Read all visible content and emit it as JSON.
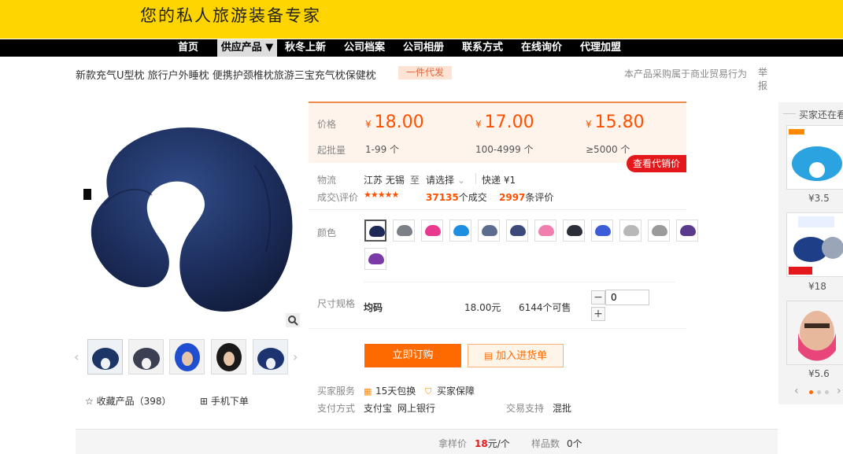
{
  "banner": {
    "slogan": "您的私人旅游装备专家"
  },
  "nav": {
    "items": [
      "首页",
      "供应产品 ▼",
      "秋冬上新",
      "公司档案",
      "公司相册",
      "联系方式",
      "在线询价",
      "代理加盟"
    ],
    "active_index": 1
  },
  "product": {
    "title": "新款充气U型枕 旅行户外睡枕 便携护颈椎枕旅游三宝充气枕保健枕",
    "tag": "一件代发",
    "trade_note": "本产品采购属于商业贸易行为",
    "report": "举报"
  },
  "gallery": {
    "favorite": "收藏产品（398）",
    "mobile_order": "手机下单",
    "thumb_colors": [
      "#1d3566",
      "#3a4052",
      "#1f4fd0",
      "#1a1a1a",
      "#1e3470"
    ]
  },
  "pricing": {
    "price_label": "价格",
    "moq_label": "起批量",
    "currency": "¥",
    "tiers": [
      {
        "price": "18.00",
        "range": "1-99 个"
      },
      {
        "price": "17.00",
        "range": "100-4999 个"
      },
      {
        "price": "15.80",
        "range": "≥5000 个"
      }
    ],
    "agent_price_button": "查看代销价"
  },
  "logistics": {
    "label": "物流",
    "origin": "江苏 无锡",
    "to": "至",
    "select": "请选择",
    "express": "快递 ¥1"
  },
  "deals": {
    "label": "成交\\评价",
    "stars": "★★★★★",
    "count": "37135",
    "count_suffix": "个成交",
    "reviews": "2997",
    "reviews_suffix": "条评价"
  },
  "colors": {
    "label": "颜色",
    "swatches": [
      "#1d2a55",
      "#7d7f86",
      "#e8388f",
      "#1e8fe0",
      "#5b6c8f",
      "#3b4a7a",
      "#f07fb0",
      "#2c2f3a",
      "#3d5cd8",
      "#b8b8b8",
      "#9a9a9a",
      "#5a3a8a",
      "#7a3aa8"
    ],
    "selected_index": 0
  },
  "spec": {
    "label": "尺寸规格",
    "name": "均码",
    "price": "18.00元",
    "stock": "6144个可售",
    "quantity": "0",
    "minus": "−",
    "plus": "+"
  },
  "actions": {
    "order": "立即订购",
    "cart": "加入进货单"
  },
  "services": {
    "label": "买家服务",
    "items": [
      "15天包换",
      "买家保障"
    ],
    "payment_label": "支付方式",
    "payment_methods": [
      "支付宝",
      "网上银行"
    ],
    "trade_support_label": "交易支持",
    "trade_support": "混批"
  },
  "bottom": {
    "sample_price_label": "拿样价",
    "sample_price": "18",
    "sample_price_unit": "元/个",
    "sample_count_label": "样品数",
    "sample_count": "0个"
  },
  "sidebar": {
    "title": "买家还在看",
    "items": [
      {
        "price": "¥3.5",
        "color": "#2aa3e0"
      },
      {
        "price": "¥18",
        "color": "#1e3f88"
      },
      {
        "price": "¥5.6",
        "color": "#e8457a"
      }
    ],
    "prev": "‹",
    "next": "›"
  }
}
